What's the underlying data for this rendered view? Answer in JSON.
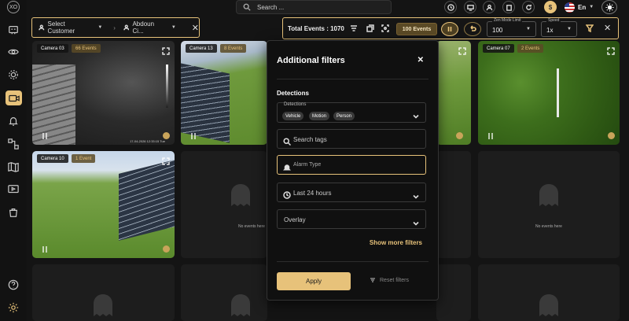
{
  "app": {
    "logo_text": "XO"
  },
  "search": {
    "placeholder": "Search ..."
  },
  "top_actions": [
    "clock-icon",
    "monitor-icon",
    "user-icon",
    "building-icon",
    "refresh-icon",
    "coins-icon"
  ],
  "language": {
    "label": "En",
    "flag": "us-flag"
  },
  "sidebar": {
    "items": [
      "dashboard-icon",
      "eye-icon",
      "settings-icon",
      "camera-icon",
      "bell-icon",
      "nodes-icon",
      "map-icon",
      "play-icon",
      "bag-icon"
    ],
    "active": "camera-icon",
    "bottom": [
      "help-icon",
      "gear-icon"
    ]
  },
  "customer_bar": {
    "customer_label": "Select Customer",
    "site_label": "Abdoun Ci..."
  },
  "controls": {
    "total_events": "Total Events : 1070",
    "events_button": "100 Events",
    "zen_mode_limit": {
      "label": "Zen Mode Limit",
      "value": "100"
    },
    "speed": {
      "label": "Speed",
      "value": "1x"
    }
  },
  "tiles": [
    {
      "camera": "Camera 03",
      "badge": "66 Events",
      "timestamp": "17-04-2026 12:33:15 Tue"
    },
    {
      "camera": "Camera 13",
      "badge": "8 Events"
    },
    {
      "camera": "Camera 07",
      "badge": "2 Events"
    },
    {
      "camera": "Camera 10",
      "badge": "1 Event"
    }
  ],
  "empty_tile_text": "No events here",
  "modal": {
    "title": "Additional filters",
    "section": "Detections",
    "detections_label": "Detections",
    "chips": [
      "Vehicle",
      "Motion",
      "Person"
    ],
    "search_tags_placeholder": "Search tags",
    "alarm_type_placeholder": "Alarm Type",
    "time_range": "Last 24 hours",
    "overlay": "Overlay",
    "show_more": "Show more filters",
    "apply": "Apply",
    "reset": "Reset filters"
  },
  "colors": {
    "accent": "#e7c27a",
    "background": "#141414",
    "panel": "#101010"
  }
}
